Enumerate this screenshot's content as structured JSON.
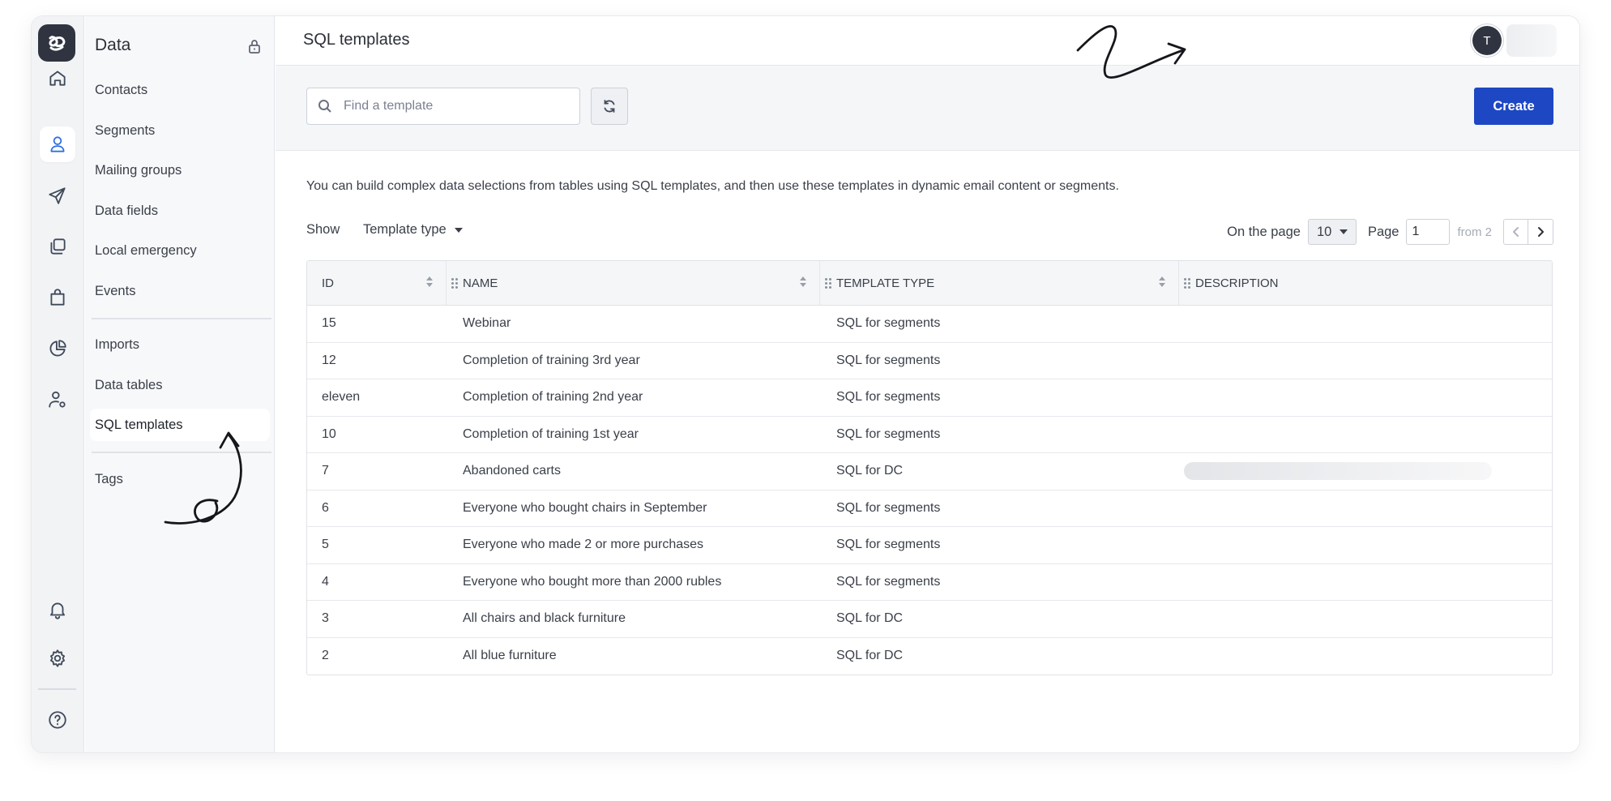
{
  "rail": {
    "items": [
      {
        "icon": "home-icon"
      },
      {
        "icon": "contacts-icon",
        "active": true
      },
      {
        "icon": "send-icon"
      },
      {
        "icon": "copy-icon"
      },
      {
        "icon": "shopping-bag-icon"
      },
      {
        "icon": "pie-chart-icon"
      },
      {
        "icon": "user-settings-icon"
      },
      {
        "icon": "bell-icon"
      },
      {
        "icon": "gear-icon"
      },
      {
        "icon": "help-icon"
      }
    ]
  },
  "sidebar": {
    "title": "Data",
    "items": [
      {
        "label": "Contacts"
      },
      {
        "label": "Segments"
      },
      {
        "label": "Mailing groups"
      },
      {
        "label": "Data fields"
      },
      {
        "label": "Local emergency"
      },
      {
        "label": "Events"
      },
      {
        "label": "Imports"
      },
      {
        "label": "Data tables"
      },
      {
        "label": "SQL templates",
        "active": true
      },
      {
        "label": "Tags"
      }
    ]
  },
  "header": {
    "title": "SQL templates",
    "avatar_initial": "T"
  },
  "toolbar": {
    "search_placeholder": "Find a template",
    "create_label": "Create"
  },
  "description": "You can build complex data selections from tables using SQL templates, and then use these templates in dynamic email content or segments.",
  "filters": {
    "show_label": "Show",
    "type_label": "Template type"
  },
  "pagination": {
    "per_page_label": "On the page",
    "per_page_value": "10",
    "page_label": "Page",
    "page_value": "1",
    "from_label": "from 2"
  },
  "table": {
    "columns": [
      "ID",
      "NAME",
      "TEMPLATE TYPE",
      "DESCRIPTION"
    ],
    "rows": [
      {
        "id": "15",
        "name": "Webinar",
        "type": "SQL for segments",
        "description": ""
      },
      {
        "id": "12",
        "name": "Completion of training 3rd year",
        "type": "SQL for segments",
        "description": ""
      },
      {
        "id": "eleven",
        "name": "Completion of training 2nd year",
        "type": "SQL for segments",
        "description": ""
      },
      {
        "id": "10",
        "name": "Completion of training 1st year",
        "type": "SQL for segments",
        "description": ""
      },
      {
        "id": "7",
        "name": "Abandoned carts",
        "type": "SQL for DC",
        "description": "",
        "description_blurred": true
      },
      {
        "id": "6",
        "name": "Everyone who bought chairs in September",
        "type": "SQL for segments",
        "description": ""
      },
      {
        "id": "5",
        "name": "Everyone who made 2 or more purchases",
        "type": "SQL for segments",
        "description": ""
      },
      {
        "id": "4",
        "name": "Everyone who bought more than 2000 rubles",
        "type": "SQL for segments",
        "description": ""
      },
      {
        "id": "3",
        "name": "All chairs and black furniture",
        "type": "SQL for DC",
        "description": ""
      },
      {
        "id": "2",
        "name": "All blue furniture",
        "type": "SQL for DC",
        "description": ""
      }
    ]
  },
  "colors": {
    "primary": "#1e47c4",
    "active_icon": "#2f6fe3",
    "rail_bg": "#f2f3f5",
    "sidebar_bg": "#f7f8fa"
  }
}
